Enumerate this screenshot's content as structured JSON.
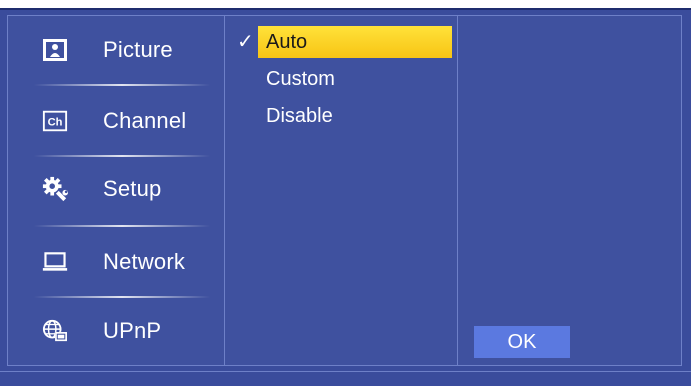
{
  "menu": {
    "items": [
      {
        "label": "Picture",
        "icon": "picture-icon"
      },
      {
        "label": "Channel",
        "icon": "channel-icon",
        "icon_text": "Ch"
      },
      {
        "label": "Setup",
        "icon": "gear-wrench-icon"
      },
      {
        "label": "Network",
        "icon": "laptop-icon"
      },
      {
        "label": "UPnP",
        "icon": "globe-network-icon"
      }
    ]
  },
  "options": {
    "items": [
      "Auto",
      "Custom",
      "Disable"
    ],
    "selected": "Auto",
    "check_mark": "✓"
  },
  "actions": {
    "ok_label": "OK"
  },
  "colors": {
    "background": "#3a4c9c",
    "panel": "#3f519f",
    "highlight": "#f7c414",
    "button": "#5b79e0",
    "text": "#ffffff"
  }
}
